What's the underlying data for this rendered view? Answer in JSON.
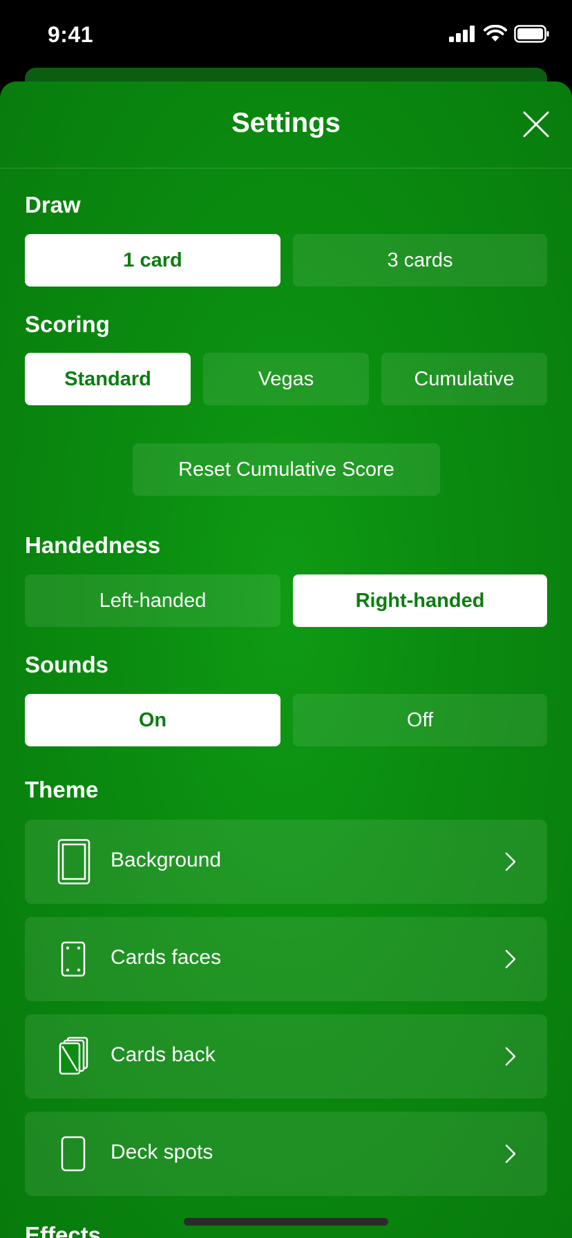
{
  "status": {
    "time": "9:41"
  },
  "header": {
    "title": "Settings"
  },
  "draw": {
    "title": "Draw",
    "options": [
      {
        "label": "1 card",
        "selected": true
      },
      {
        "label": "3 cards",
        "selected": false
      }
    ]
  },
  "scoring": {
    "title": "Scoring",
    "options": [
      {
        "label": "Standard",
        "selected": true
      },
      {
        "label": "Vegas",
        "selected": false
      },
      {
        "label": "Cumulative",
        "selected": false
      }
    ],
    "reset_label": "Reset Cumulative Score"
  },
  "handedness": {
    "title": "Handedness",
    "options": [
      {
        "label": "Left-handed",
        "selected": false
      },
      {
        "label": "Right-handed",
        "selected": true
      }
    ]
  },
  "sounds": {
    "title": "Sounds",
    "options": [
      {
        "label": "On",
        "selected": true
      },
      {
        "label": "Off",
        "selected": false
      }
    ]
  },
  "theme": {
    "title": "Theme",
    "items": [
      {
        "label": "Background",
        "icon": "background-icon"
      },
      {
        "label": "Cards faces",
        "icon": "card-face-icon"
      },
      {
        "label": "Cards back",
        "icon": "card-back-icon"
      },
      {
        "label": "Deck spots",
        "icon": "deck-spot-icon"
      }
    ]
  },
  "effects": {
    "title": "Effects"
  },
  "colors": {
    "accent": "#0b7d10",
    "background": "#0a8a0f"
  }
}
